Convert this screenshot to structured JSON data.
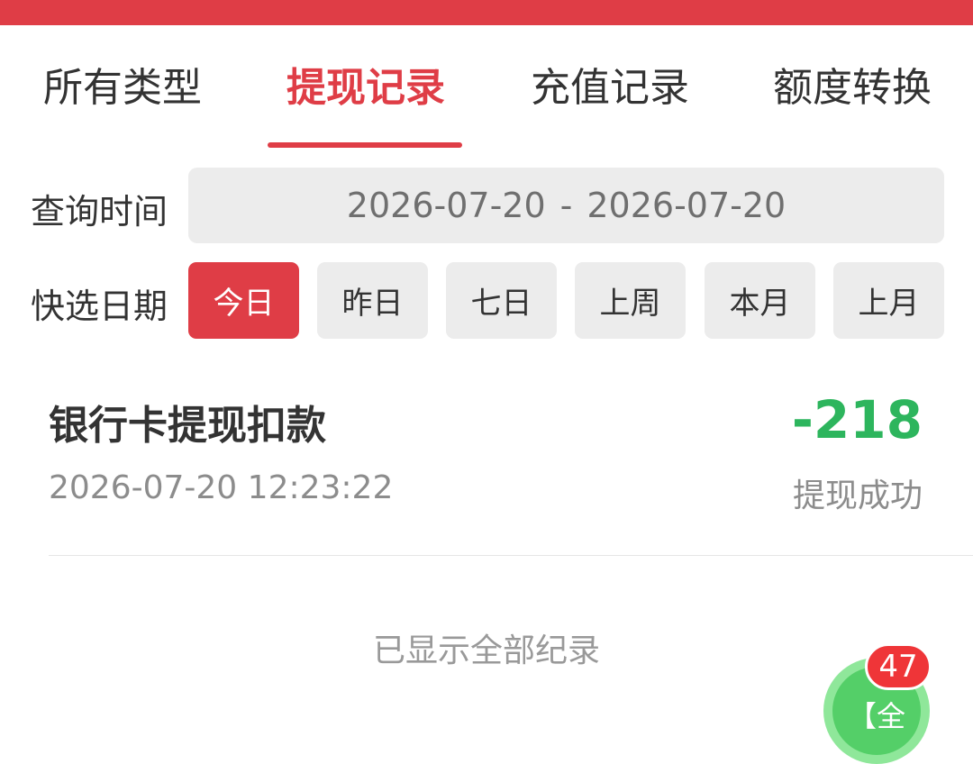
{
  "tabs": [
    {
      "label": "所有类型",
      "active": false
    },
    {
      "label": "提现记录",
      "active": true
    },
    {
      "label": "充值记录",
      "active": false
    },
    {
      "label": "额度转换",
      "active": false
    }
  ],
  "query": {
    "label": "查询时间",
    "start": "2026-07-20",
    "separator": "-",
    "end": "2026-07-20"
  },
  "quick_select": {
    "label": "快选日期",
    "options": [
      "今日",
      "昨日",
      "七日",
      "上周",
      "本月",
      "上月"
    ],
    "selected": "今日"
  },
  "records": [
    {
      "title": "银行卡提现扣款",
      "amount": "-218",
      "time": "2026-07-20 12:23:22",
      "status": "提现成功"
    }
  ],
  "footer": {
    "end_text": "已显示全部纪录"
  },
  "floating_button": {
    "label": "【全",
    "badge": "47"
  },
  "colors": {
    "accent": "#df3d46",
    "amount": "#2db55d",
    "muted": "#8c8c8c",
    "float_button": "#54cf68",
    "badge": "#ef3538"
  }
}
